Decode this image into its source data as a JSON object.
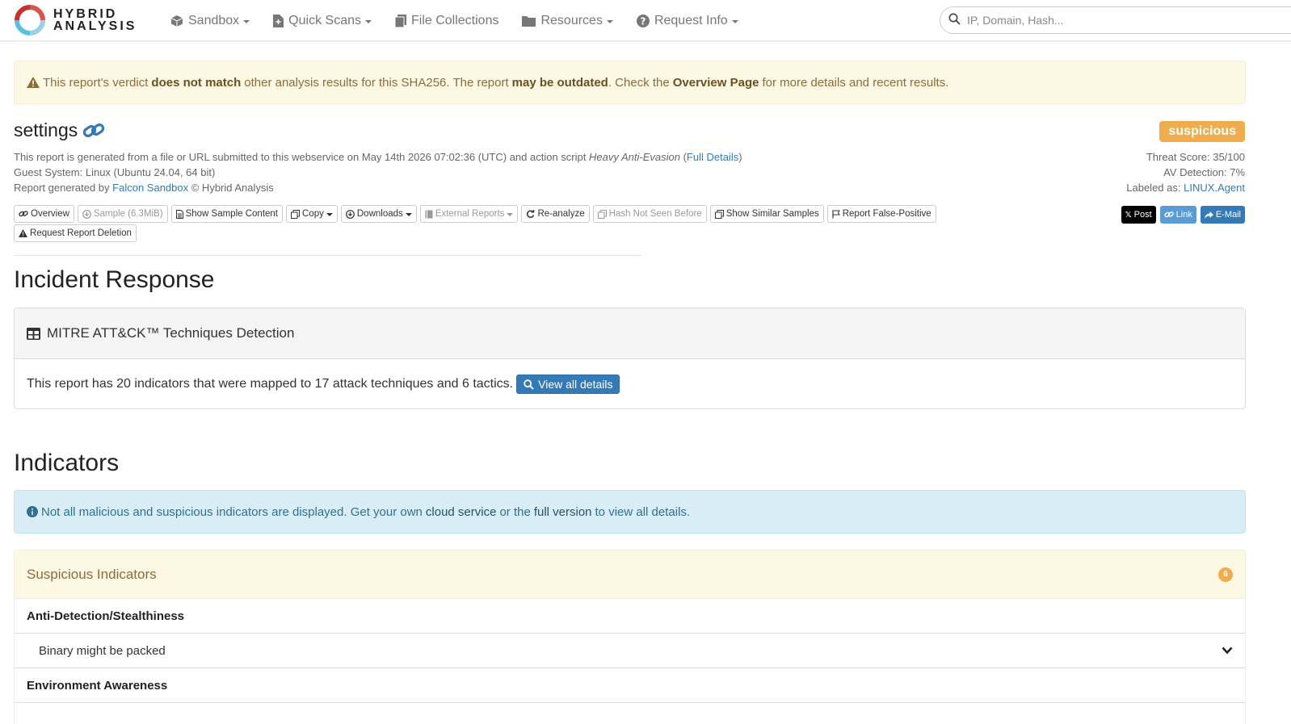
{
  "nav": {
    "logo_line1": "HYBRID",
    "logo_line2": "ANALYSIS",
    "items": [
      {
        "label": "Sandbox",
        "icon": "cube-icon"
      },
      {
        "label": "Quick Scans",
        "icon": "file-icon"
      },
      {
        "label": "File Collections",
        "icon": "files-icon"
      },
      {
        "label": "Resources",
        "icon": "folder-icon"
      },
      {
        "label": "Request Info",
        "icon": "question-icon"
      }
    ],
    "search_placeholder": "IP, Domain, Hash..."
  },
  "warning": {
    "part1": "This report's verdict",
    "bold1": "does not match",
    "part2": "other analysis results for this SHA256. The report",
    "bold2": "may be outdated",
    "part3": ". Check the",
    "bold3": "Overview Page",
    "part4": "for more details and recent results."
  },
  "report": {
    "title": "settings",
    "meta_prefix": "This report is generated from a file or URL submitted to this webservice on May 14th 2026 07:02:36 (UTC) and action script",
    "action_script": "Heavy Anti-Evasion",
    "full_details": "Full Details",
    "guest_system": "Guest System: Linux (Ubuntu 24.04, 64 bit)",
    "generated_by_prefix": "Report generated by",
    "generated_by_link": "Falcon Sandbox",
    "generated_by_suffix": "© Hybrid Analysis",
    "verdict": "suspicious",
    "threat_score": "Threat Score: 35/100",
    "av_detection": "AV Detection: 7%",
    "labeled_as_prefix": "Labeled as:",
    "labeled_as": "LINUX.Agent"
  },
  "actions": [
    {
      "label": "Overview",
      "icon": "link-icon",
      "disabled": false,
      "caret": false
    },
    {
      "label": "Sample (6.3MiB)",
      "icon": "download-circle-icon",
      "disabled": true,
      "caret": false
    },
    {
      "label": "Show Sample Content",
      "icon": "file-text-icon",
      "disabled": false,
      "caret": false
    },
    {
      "label": "Copy",
      "icon": "copy-icon",
      "disabled": false,
      "caret": true
    },
    {
      "label": "Downloads",
      "icon": "download-circle-icon",
      "disabled": false,
      "caret": true
    },
    {
      "label": "External Reports",
      "icon": "book-icon",
      "disabled": true,
      "caret": true
    },
    {
      "label": "Re-analyze",
      "icon": "refresh-icon",
      "disabled": false,
      "caret": false
    },
    {
      "label": "Hash Not Seen Before",
      "icon": "clone-icon",
      "disabled": true,
      "caret": false
    },
    {
      "label": "Show Similar Samples",
      "icon": "clone-icon",
      "disabled": false,
      "caret": false
    },
    {
      "label": "Report False-Positive",
      "icon": "flag-icon",
      "disabled": false,
      "caret": false
    },
    {
      "label": "Request Report Deletion",
      "icon": "warning-icon",
      "disabled": false,
      "caret": false
    }
  ],
  "share": {
    "post": "Post",
    "link": "Link",
    "email": "E-Mail",
    "colors": {
      "post": "#000000",
      "link": "#5bc0de",
      "email": "#337ab7"
    }
  },
  "incident": {
    "heading": "Incident Response",
    "panel_title": "MITRE ATT&CK™ Techniques Detection",
    "summary": "This report has 20 indicators that were mapped to 17 attack techniques and 6 tactics.",
    "view_button": "View all details"
  },
  "indicators": {
    "heading": "Indicators",
    "info_part1": "Not all malicious and suspicious indicators are displayed. Get your own",
    "info_link1": "cloud service",
    "info_part2": "or the",
    "info_link2": "full version",
    "info_part3": "to view all details.",
    "suspicious_title": "Suspicious Indicators",
    "suspicious_count": "6",
    "categories": [
      {
        "name": "Anti-Detection/Stealthiness",
        "items": [
          "Binary might be packed"
        ]
      },
      {
        "name": "Environment Awareness",
        "items": []
      }
    ]
  },
  "colors": {
    "brand_blue": "#337ab7",
    "warning_bg": "#fcf8e3",
    "warning_text": "#8a6d3b",
    "info_bg": "#d9edf7",
    "suspicious_orange": "#f0ad4e"
  }
}
